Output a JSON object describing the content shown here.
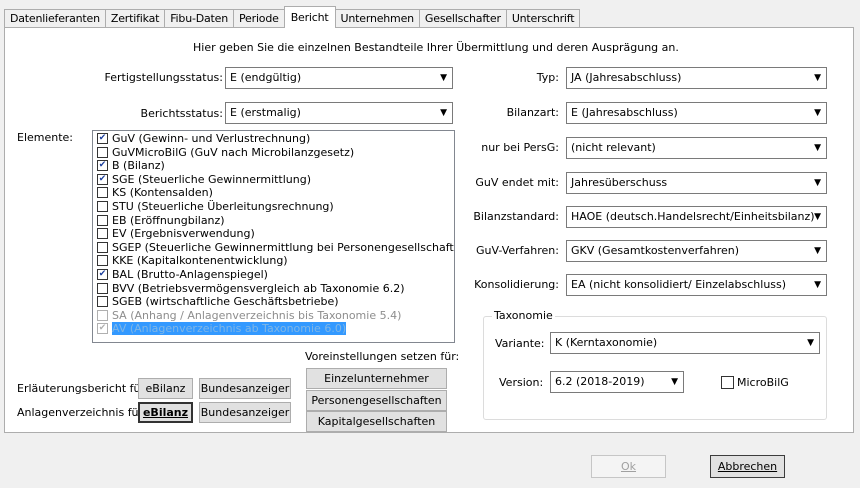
{
  "tabs": [
    {
      "label": "Datenlieferanten"
    },
    {
      "label": "Zertifikat"
    },
    {
      "label": "Fibu-Daten"
    },
    {
      "label": "Periode"
    },
    {
      "label": "Bericht"
    },
    {
      "label": "Unternehmen"
    },
    {
      "label": "Gesellschafter"
    },
    {
      "label": "Unterschrift"
    }
  ],
  "intro": "Hier geben Sie die einzelnen Bestandteile Ihrer Übermittlung und deren Ausprägung an.",
  "left": {
    "fertigstellung_label": "Fertigstellungsstatus:",
    "fertigstellung_value": "E (endgültig)",
    "berichtsstatus_label": "Berichtsstatus:",
    "berichtsstatus_value": "E (erstmalig)",
    "elemente_label": "Elemente:",
    "elements": [
      {
        "label": "GuV (Gewinn- und Verlustrechnung)",
        "checked": true
      },
      {
        "label": "GuVMicroBilG (GuV nach Microbilanzgesetz)",
        "checked": false
      },
      {
        "label": "B (Bilanz)",
        "checked": true
      },
      {
        "label": "SGE (Steuerliche Gewinnermittlung)",
        "checked": true
      },
      {
        "label": "KS (Kontensalden)",
        "checked": false
      },
      {
        "label": "STU (Steuerliche Überleitungsrechnung)",
        "checked": false
      },
      {
        "label": "EB (Eröffnungbilanz)",
        "checked": false
      },
      {
        "label": "EV (Ergebnisverwendung)",
        "checked": false
      },
      {
        "label": "SGEP (Steuerliche Gewinnermittlung bei Personengesellschaften)",
        "checked": false
      },
      {
        "label": "KKE (Kapitalkontenentwicklung)",
        "checked": false
      },
      {
        "label": "BAL (Brutto-Anlagenspiegel)",
        "checked": true
      },
      {
        "label": "BVV (Betriebsvermögensvergleich ab Taxonomie 6.2)",
        "checked": false
      },
      {
        "label": "SGEB (wirtschaftliche Geschäftsbetriebe)",
        "checked": false
      },
      {
        "label": "SA (Anhang / Anlagenverzeichnis bis Taxonomie 5.4)",
        "checked": false,
        "disabled": true
      },
      {
        "label": "AV (Anlagenverzeichnis ab Taxonomie 6.0)",
        "checked": true,
        "disabled": true,
        "selected": true
      }
    ],
    "voreinstellungen_label": "Voreinstellungen setzen für:",
    "preset_buttons": [
      "Einzelunternehmer",
      "Personengesellschaften",
      "Kapitalgesellschaften"
    ],
    "erlaeuterung_label": "Erläuterungsbericht für",
    "anlagen_label": "Anlagenverzeichnis für",
    "ebilanz_label": "eBilanz",
    "bundesanzeiger_label": "Bundesanzeiger"
  },
  "right": {
    "fields": [
      {
        "label": "Typ:",
        "value": "JA (Jahresabschluss)"
      },
      {
        "label": "Bilanzart:",
        "value": "E (Jahresabschluss)"
      },
      {
        "label": "nur bei PersG:",
        "value": "(nicht relevant)"
      },
      {
        "label": "GuV endet mit:",
        "value": "Jahresüberschuss"
      },
      {
        "label": "Bilanzstandard:",
        "value": "HAOE (deutsch.Handelsrecht/Einheitsbilanz)"
      },
      {
        "label": "GuV-Verfahren:",
        "value": "GKV (Gesamtkostenverfahren)"
      },
      {
        "label": "Konsolidierung:",
        "value": "EA (nicht konsolidiert/ Einzelabschluss)"
      }
    ],
    "taxonomie": {
      "title": "Taxonomie",
      "variante_label": "Variante:",
      "variante_value": "K (Kerntaxonomie)",
      "version_label": "Version:",
      "version_value": "6.2 (2018-2019)",
      "microbilg_label": "MicroBilG",
      "microbilg_checked": false
    }
  },
  "footer": {
    "ok_label": "Ok",
    "cancel_label": "Abbrechen"
  },
  "icons": {
    "dropdown": "chevron-down-icon",
    "check": "checkmark-icon"
  }
}
